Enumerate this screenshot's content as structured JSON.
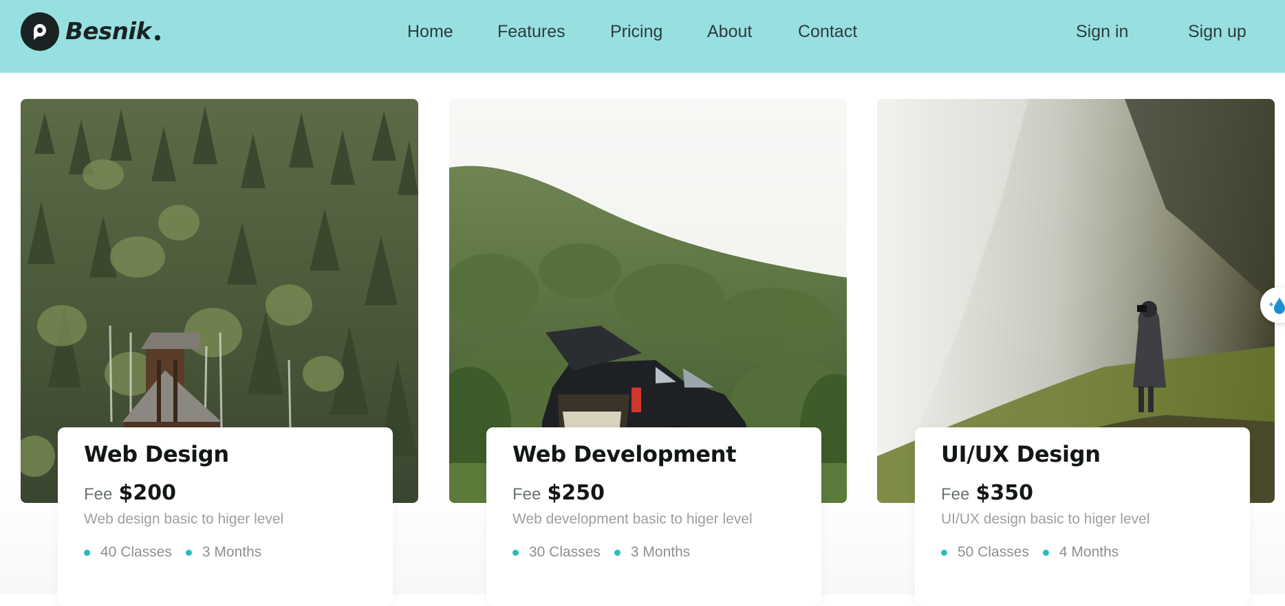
{
  "brand": {
    "name": "Besnik"
  },
  "nav": {
    "items": [
      {
        "label": "Home"
      },
      {
        "label": "Features"
      },
      {
        "label": "Pricing"
      },
      {
        "label": "About"
      },
      {
        "label": "Contact"
      }
    ],
    "sign_in": "Sign in",
    "sign_up": "Sign up"
  },
  "colors": {
    "header_bg": "#98e0e0",
    "accent_dot": "#2cbcb7",
    "text_dark": "#121616"
  },
  "cards": [
    {
      "title": "Web Design",
      "fee_label": "Fee",
      "fee": "$200",
      "description": "Web design basic to higer level",
      "classes": "40 Classes",
      "duration": "3 Months"
    },
    {
      "title": "Web Development",
      "fee_label": "Fee",
      "fee": "$250",
      "description": "Web development basic to higer level",
      "classes": "30 Classes",
      "duration": "3 Months"
    },
    {
      "title": "UI/UX Design",
      "fee_label": "Fee",
      "fee": "$350",
      "description": "UI/UX design basic to higer level",
      "classes": "50 Classes",
      "duration": "4 Months"
    }
  ],
  "side_widget": {
    "icon": "water-drop-sparkle-icon"
  }
}
